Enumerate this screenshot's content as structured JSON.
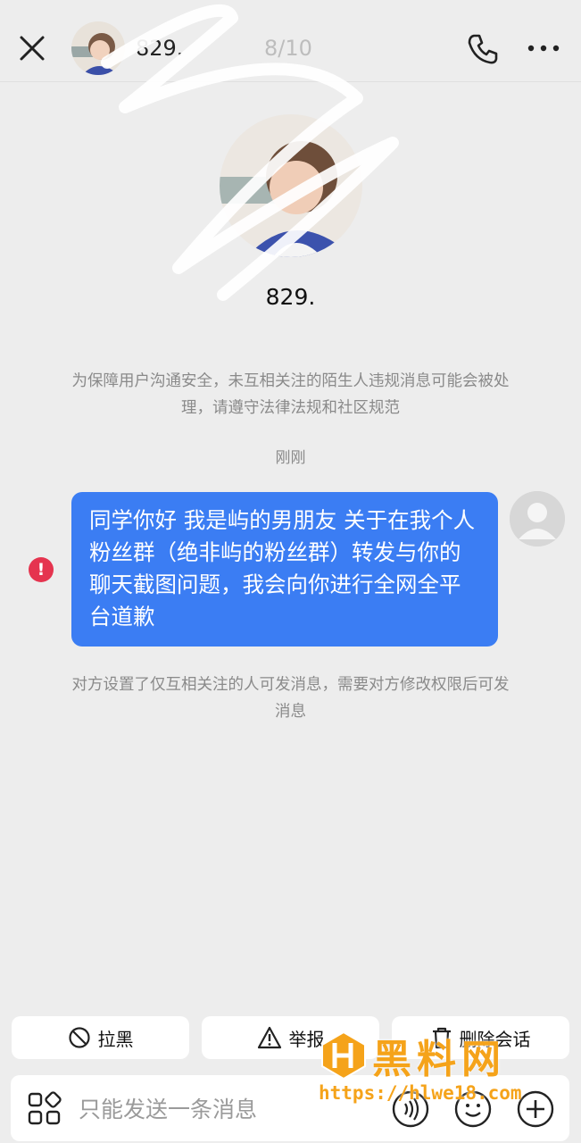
{
  "header": {
    "name": "829.",
    "counter": "8/10"
  },
  "profile": {
    "name": "829."
  },
  "notices": {
    "safety": "为保障用户沟通安全，未互相关注的陌生人违规消息可能会被处理，请遵守法律法规和社区规范",
    "timestamp": "刚刚",
    "restriction": "对方设置了仅互相关注的人可发消息，需要对方修改权限后可发消息"
  },
  "message": {
    "text": "同学你好 我是屿的男朋友 关于在我个人粉丝群（绝非屿的粉丝群）转发与你的聊天截图问题，我会向你进行全网全平台道歉",
    "status_icon": "!"
  },
  "actions": {
    "block": "拉黑",
    "report": "举报",
    "delete": "删除会话"
  },
  "input": {
    "placeholder": "只能发送一条消息"
  },
  "watermark": {
    "brand": "黑料网",
    "url": "https://hlwe18.com"
  },
  "colors": {
    "bubble": "#3b7df3",
    "error": "#e5344f",
    "background": "#ededed"
  }
}
